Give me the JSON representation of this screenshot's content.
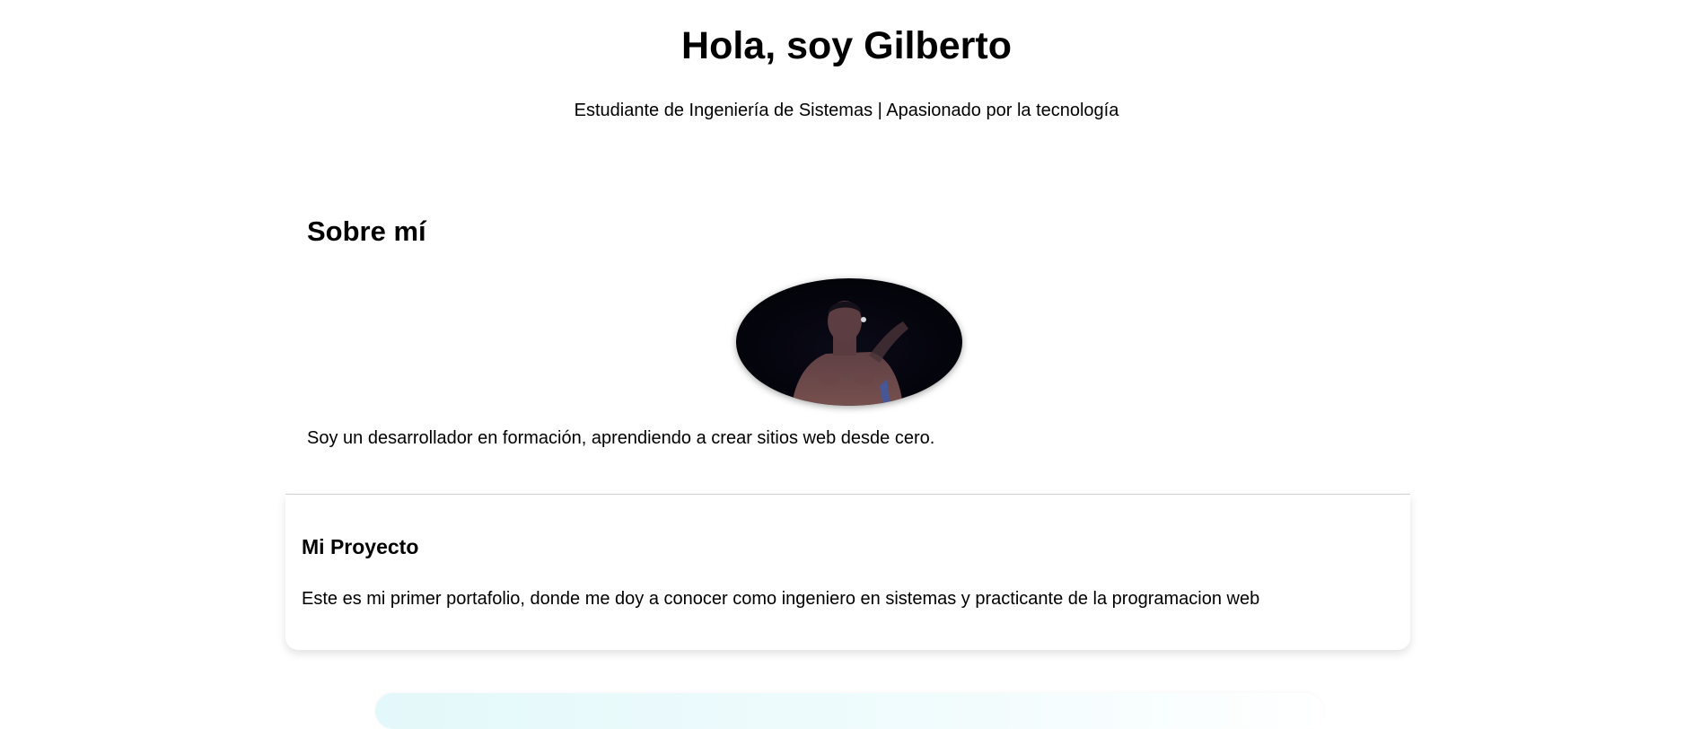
{
  "header": {
    "title": "Hola, soy Gilberto",
    "subtitle": "Estudiante de Ingeniería de Sistemas | Apasionado por la tecnología"
  },
  "about": {
    "heading": "Sobre mí",
    "photo_alt": "profile-photo",
    "text": "Soy un desarrollador en formación, aprendiendo a crear sitios web desde cero."
  },
  "project": {
    "heading": "Mi Proyecto",
    "text": "Este es mi primer portafolio, donde me doy a conocer como ingeniero en sistemas y practicante de la programacion web"
  },
  "colors": {
    "text": "#000000",
    "background": "#ffffff",
    "divider": "#d6d6d6",
    "next_section_tint": "#e3f8fa"
  }
}
